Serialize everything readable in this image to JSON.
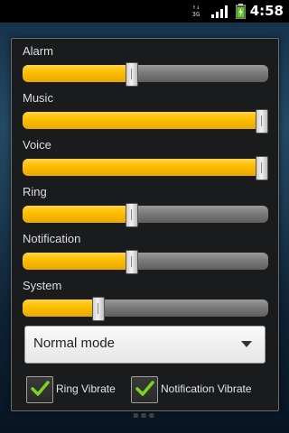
{
  "statusbar": {
    "network": "3G",
    "time": "4:58",
    "icons": [
      "3g-icon",
      "signal-icon",
      "battery-icon"
    ]
  },
  "dialog": {
    "sliders": [
      {
        "label": "Alarm",
        "value": 0.44
      },
      {
        "label": "Music",
        "value": 1.0
      },
      {
        "label": "Voice",
        "value": 1.0
      },
      {
        "label": "Ring",
        "value": 0.44
      },
      {
        "label": "Notification",
        "value": 0.44
      },
      {
        "label": "System",
        "value": 0.3
      }
    ],
    "mode": {
      "selected": "Normal mode"
    },
    "checkboxes": [
      {
        "label": "Ring Vibrate",
        "checked": true
      },
      {
        "label": "Notification Vibrate",
        "checked": true
      }
    ]
  },
  "colors": {
    "accent": "#ffbf00",
    "track": "#7a7a7a",
    "check": "#7ed321",
    "dialog_bg": "#1a1b1d"
  }
}
